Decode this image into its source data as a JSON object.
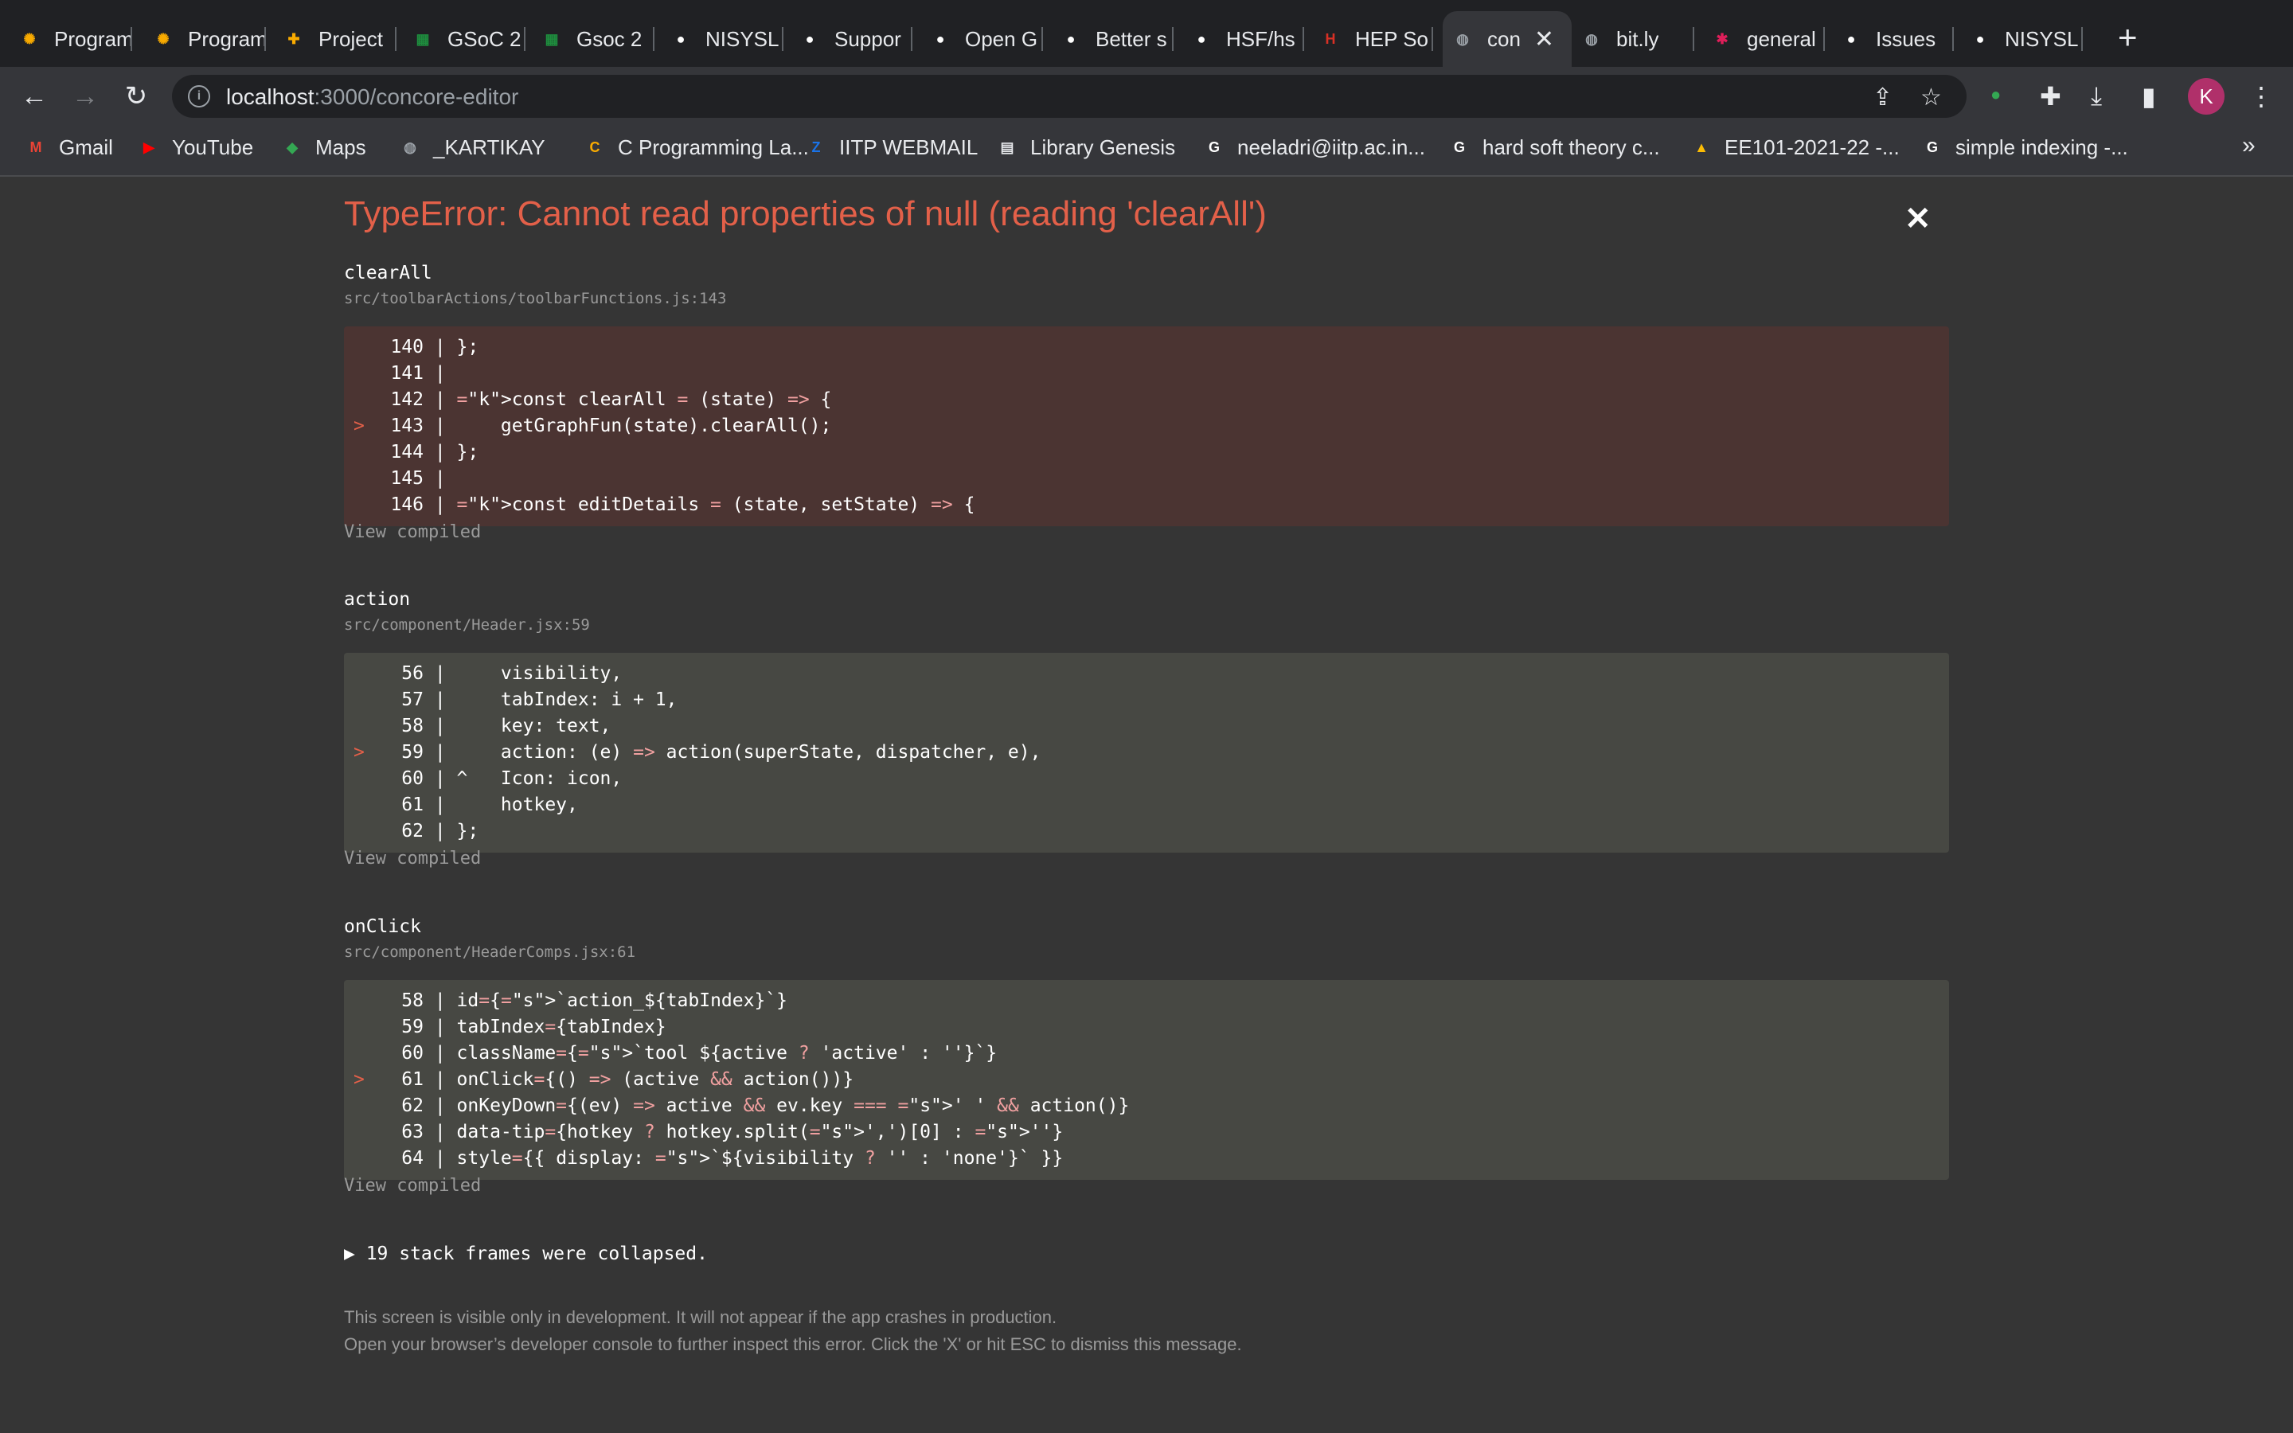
{
  "tabs": [
    {
      "label": "Program",
      "favicon": "gear-icon",
      "color": "#f9ab00",
      "active": false
    },
    {
      "label": "Program",
      "favicon": "gear-icon",
      "color": "#f9ab00",
      "active": false
    },
    {
      "label": "Project",
      "favicon": "plus-icon",
      "color": "#f9ab00",
      "active": false
    },
    {
      "label": "GSoC 2",
      "favicon": "sheets-icon",
      "color": "#1e8e3e",
      "active": false
    },
    {
      "label": "Gsoc 2",
      "favicon": "sheets-icon",
      "color": "#1e8e3e",
      "active": false
    },
    {
      "label": "NISYSL",
      "favicon": "github-icon",
      "color": "#ffffff",
      "active": false
    },
    {
      "label": "Suppor",
      "favicon": "github-icon",
      "color": "#ffffff",
      "active": false
    },
    {
      "label": "Open G",
      "favicon": "github-icon",
      "color": "#ffffff",
      "active": false
    },
    {
      "label": "Better s",
      "favicon": "github-icon",
      "color": "#ffffff",
      "active": false
    },
    {
      "label": "HSF/hs",
      "favicon": "github-icon",
      "color": "#ffffff",
      "active": false
    },
    {
      "label": "HEP So",
      "favicon": "hsf-icon",
      "color": "#d93025",
      "active": false
    },
    {
      "label": "con",
      "favicon": "globe-icon",
      "color": "#9aa0a6",
      "active": true
    },
    {
      "label": "bit.ly",
      "favicon": "globe-icon",
      "color": "#9aa0a6",
      "active": false
    },
    {
      "label": "general",
      "favicon": "slack-icon",
      "color": "#e01e5a",
      "active": false
    },
    {
      "label": "Issues",
      "favicon": "github-icon",
      "color": "#ffffff",
      "active": false
    },
    {
      "label": "NISYSL",
      "favicon": "github-icon",
      "color": "#ffffff",
      "active": false
    }
  ],
  "address": {
    "host": "localhost",
    "rest": ":3000/concore-editor"
  },
  "avatar_letter": "K",
  "bookmarks": [
    {
      "label": "Gmail",
      "icon": "gmail-icon",
      "color": "#ea4335"
    },
    {
      "label": "YouTube",
      "icon": "youtube-icon",
      "color": "#ff0000"
    },
    {
      "label": "Maps",
      "icon": "maps-icon",
      "color": "#34a853"
    },
    {
      "label": "_KARTIKAY",
      "icon": "globe-icon",
      "color": "#9aa0a6"
    },
    {
      "label": "C Programming La...",
      "icon": "cprog-icon",
      "color": "#f9ab00"
    },
    {
      "label": "IITP WEBMAIL",
      "icon": "zimbra-icon",
      "color": "#1a73e8"
    },
    {
      "label": "Library Genesis",
      "icon": "book-icon",
      "color": "#e8eaed"
    },
    {
      "label": "neeladri@iitp.ac.in...",
      "icon": "google-icon",
      "color": "#ffffff"
    },
    {
      "label": "hard soft theory c...",
      "icon": "google-icon",
      "color": "#ffffff"
    },
    {
      "label": "EE101-2021-22 -...",
      "icon": "drive-icon",
      "color": "#fbbc04"
    },
    {
      "label": "simple indexing -...",
      "icon": "google-icon",
      "color": "#ffffff"
    }
  ],
  "error": {
    "title": "TypeError: Cannot read properties of null (reading 'clearAll')",
    "frames": [
      {
        "name": "clearAll",
        "file": "src/toolbarActions/toolbarFunctions.js:143",
        "highlight": "red",
        "lines": [
          {
            "no": "140",
            "mark": "",
            "code": "};"
          },
          {
            "no": "141",
            "mark": "",
            "code": ""
          },
          {
            "no": "142",
            "mark": "",
            "code": "const clearAll = (state) => {"
          },
          {
            "no": "143",
            "mark": ">",
            "code": "    getGraphFun(state).clearAll();"
          },
          {
            "no": "144",
            "mark": "",
            "code": "};"
          },
          {
            "no": "145",
            "mark": "",
            "code": ""
          },
          {
            "no": "146",
            "mark": "",
            "code": "const editDetails = (state, setState) => {"
          }
        ]
      },
      {
        "name": "action",
        "file": "src/component/Header.jsx:59",
        "highlight": "gray",
        "lines": [
          {
            "no": "56",
            "mark": "",
            "code": "    visibility,"
          },
          {
            "no": "57",
            "mark": "",
            "code": "    tabIndex: i + 1,"
          },
          {
            "no": "58",
            "mark": "",
            "code": "    key: text,"
          },
          {
            "no": "59",
            "mark": ">",
            "code": "    action: (e) => action(superState, dispatcher, e),"
          },
          {
            "no": "60",
            "mark": "",
            "code": "^   Icon: icon,"
          },
          {
            "no": "61",
            "mark": "",
            "code": "    hotkey,"
          },
          {
            "no": "62",
            "mark": "",
            "code": "};"
          }
        ]
      },
      {
        "name": "onClick",
        "file": "src/component/HeaderComps.jsx:61",
        "highlight": "gray",
        "lines": [
          {
            "no": "58",
            "mark": "",
            "code": "id={`action_${tabIndex}`}"
          },
          {
            "no": "59",
            "mark": "",
            "code": "tabIndex={tabIndex}"
          },
          {
            "no": "60",
            "mark": "",
            "code": "className={`tool ${active ? 'active' : ''}`}"
          },
          {
            "no": "61",
            "mark": ">",
            "code": "onClick={() => (active && action())}"
          },
          {
            "no": "62",
            "mark": "",
            "code": "onKeyDown={(ev) => active && ev.key === ' ' && action()}"
          },
          {
            "no": "63",
            "mark": "",
            "code": "data-tip={hotkey ? hotkey.split(',')[0] : ''}"
          },
          {
            "no": "64",
            "mark": "",
            "code": "style={{ display: `${visibility ? '' : 'none'}` }}"
          }
        ]
      }
    ],
    "view_compiled": "View compiled",
    "collapsed": "▶ 19 stack frames were collapsed.",
    "footer_line1": "This screen is visible only in development. It will not appear if the app crashes in production.",
    "footer_line2": "Open your browser’s developer console to further inspect this error.  Click the 'X' or hit ESC to dismiss this message."
  }
}
